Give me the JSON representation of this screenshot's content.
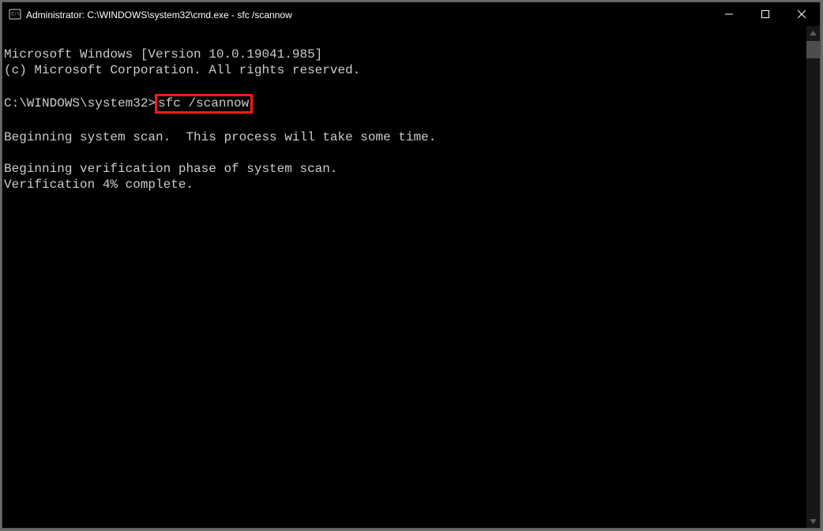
{
  "window": {
    "title": "Administrator: C:\\WINDOWS\\system32\\cmd.exe - sfc  /scannow"
  },
  "console": {
    "line1": "Microsoft Windows [Version 10.0.19041.985]",
    "line2": "(c) Microsoft Corporation. All rights reserved.",
    "blank1": " ",
    "prompt": "C:\\WINDOWS\\system32>",
    "command": "sfc /scannow",
    "blank2": " ",
    "line3": "Beginning system scan.  This process will take some time.",
    "blank3": " ",
    "line4": "Beginning verification phase of system scan.",
    "line5": "Verification 4% complete."
  },
  "highlight_color": "#ff1a1a"
}
